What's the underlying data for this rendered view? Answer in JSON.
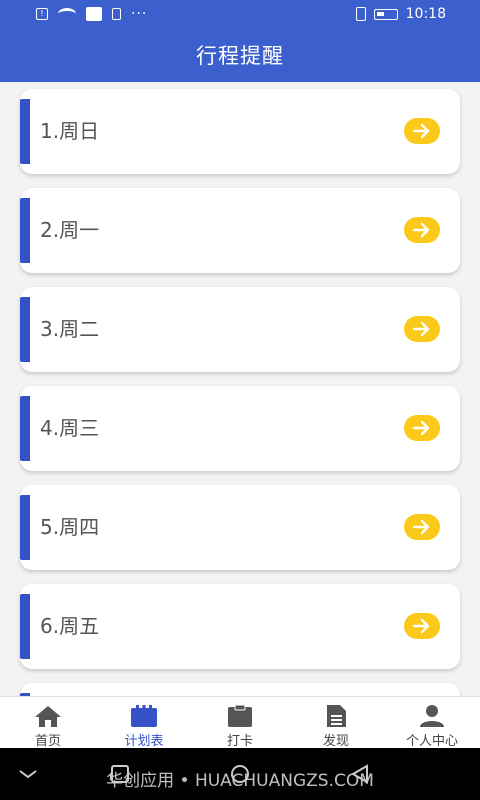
{
  "status_bar": {
    "time": "10:18",
    "left_icons": [
      "alert-icon",
      "wifi-icon",
      "camera-icon",
      "sim-icon",
      "more-icon"
    ],
    "more_text": "···",
    "right_icons": [
      "vibrate-icon",
      "battery-icon"
    ]
  },
  "header": {
    "title": "行程提醒"
  },
  "schedule": {
    "items": [
      {
        "label": "1.周日"
      },
      {
        "label": "2.周一"
      },
      {
        "label": "3.周二"
      },
      {
        "label": "4.周三"
      },
      {
        "label": "5.周四"
      },
      {
        "label": "6.周五"
      }
    ],
    "arrow_icon": "arrow-right-circle-icon",
    "accent_color": "#3451c7",
    "arrow_color": "#fbc91a"
  },
  "tab_bar": {
    "tabs": [
      {
        "label": "首页",
        "icon": "home-icon"
      },
      {
        "label": "计划表",
        "icon": "calendar-icon",
        "active": true
      },
      {
        "label": "打卡",
        "icon": "clipboard-icon"
      },
      {
        "label": "发现",
        "icon": "document-icon"
      },
      {
        "label": "个人中心",
        "icon": "user-icon"
      }
    ],
    "active_color": "#3451c7"
  },
  "nav_bar": {
    "watermark": "华创应用 • HUACHUANGZS.COM",
    "buttons": [
      "collapse-icon",
      "square-icon",
      "circle-icon",
      "back-triangle-icon"
    ]
  },
  "colors": {
    "primary": "#3c5fce",
    "background": "#f3f3f3"
  }
}
